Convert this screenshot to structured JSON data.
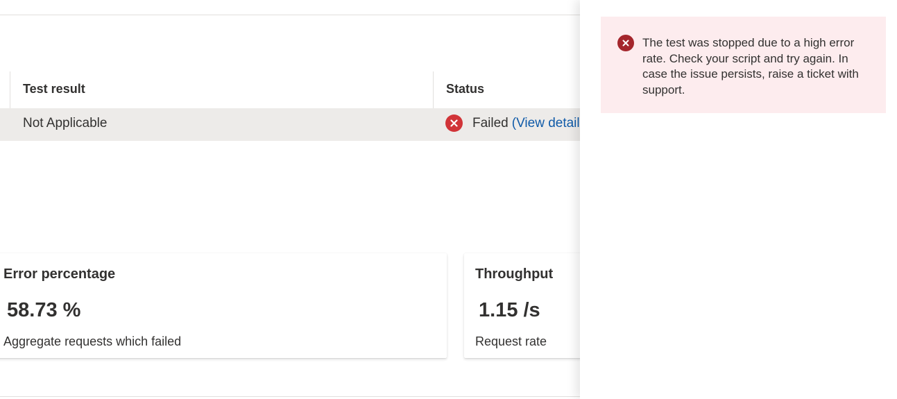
{
  "table": {
    "headers": {
      "test_result": "Test result",
      "status": "Status"
    },
    "row": {
      "test_result": "Not Applicable",
      "status": "Failed",
      "status_link": "(View detail"
    }
  },
  "metrics": [
    {
      "title": "Error percentage",
      "value": "58.73 %",
      "subtitle": "Aggregate requests which failed"
    },
    {
      "title": "Throughput",
      "value": "1.15 /s",
      "subtitle": "Request rate"
    }
  ],
  "panel": {
    "error_message": "The test was stopped due to a high error rate. Check your script and try again. In case the issue persists, raise a ticket with support."
  },
  "icons": {
    "status": "error-circle-icon",
    "message": "error-circle-icon"
  },
  "colors": {
    "failed_icon": "#d13438",
    "message_icon": "#a4262c",
    "link": "#0f5aa8",
    "error_bg": "#fdecee",
    "row_bg": "#edebe9"
  }
}
